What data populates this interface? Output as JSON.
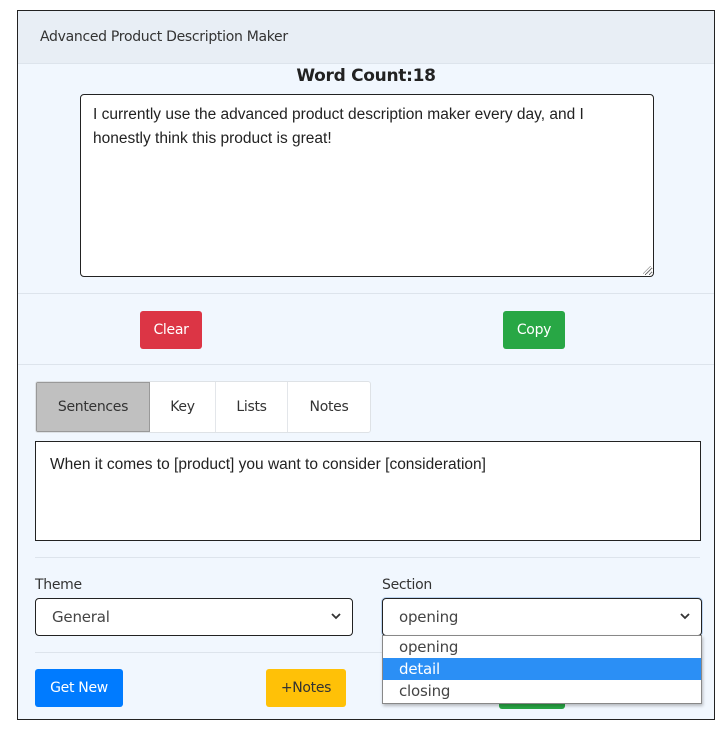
{
  "header": {
    "title": "Advanced Product Description Maker"
  },
  "word_count": {
    "label": "Word Count:",
    "value": "18",
    "text": "Word Count:18"
  },
  "main_text": " I currently use the advanced product description maker every day, and I honestly think this product is great!",
  "actions": {
    "clear_label": "Clear",
    "copy_label": "Copy"
  },
  "tabs": [
    {
      "label": "Sentences",
      "active": true
    },
    {
      "label": "Key",
      "active": false
    },
    {
      "label": "Lists",
      "active": false
    },
    {
      "label": "Notes",
      "active": false
    }
  ],
  "sentence_text": "When it comes to [product] you want to consider [consideration]",
  "theme": {
    "label": "Theme",
    "selected": "General"
  },
  "section": {
    "label": "Section",
    "selected": "opening",
    "options": [
      "opening",
      "detail",
      "closing"
    ],
    "highlighted": "detail"
  },
  "bottom_buttons": {
    "get_new_label": "Get New",
    "notes_label": "+Notes"
  },
  "colors": {
    "danger": "#dc3545",
    "success": "#28a745",
    "primary": "#007bff",
    "warning": "#ffc107",
    "highlight": "#2b8ff5"
  }
}
